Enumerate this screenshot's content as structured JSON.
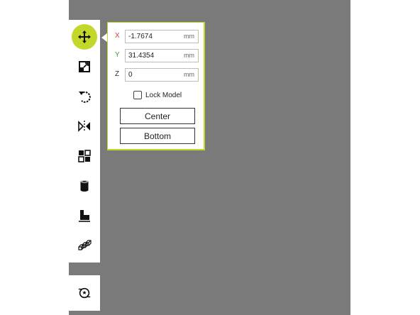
{
  "toolbar": {
    "tools": [
      {
        "name": "move",
        "icon": "move-icon",
        "active": true
      },
      {
        "name": "scale",
        "icon": "scale-icon",
        "active": false
      },
      {
        "name": "rotate",
        "icon": "rotate-icon",
        "active": false
      },
      {
        "name": "mirror",
        "icon": "mirror-icon",
        "active": false
      },
      {
        "name": "per-model-settings",
        "icon": "per-model-settings-icon",
        "active": false
      },
      {
        "name": "support-blocker",
        "icon": "support-blocker-icon",
        "active": false
      },
      {
        "name": "lay-flat",
        "icon": "lay-flat-icon",
        "active": false
      },
      {
        "name": "arrange",
        "icon": "arrange-icon",
        "active": false
      }
    ],
    "bottom_tool": {
      "name": "extensions",
      "icon": "extensions-icon"
    }
  },
  "move_panel": {
    "x": {
      "label": "X",
      "value": "-1.7674",
      "unit": "mm",
      "color": "#e53935"
    },
    "y": {
      "label": "Y",
      "value": "31.4354",
      "unit": "mm",
      "color": "#43a047"
    },
    "z": {
      "label": "Z",
      "value": "0",
      "unit": "mm",
      "color": "#333333"
    },
    "lock_model": {
      "label": "Lock Model",
      "checked": false
    },
    "center_label": "Center",
    "bottom_label": "Bottom"
  },
  "colors": {
    "accent": "#c4d72b",
    "viewport": "#7a7a7a"
  }
}
